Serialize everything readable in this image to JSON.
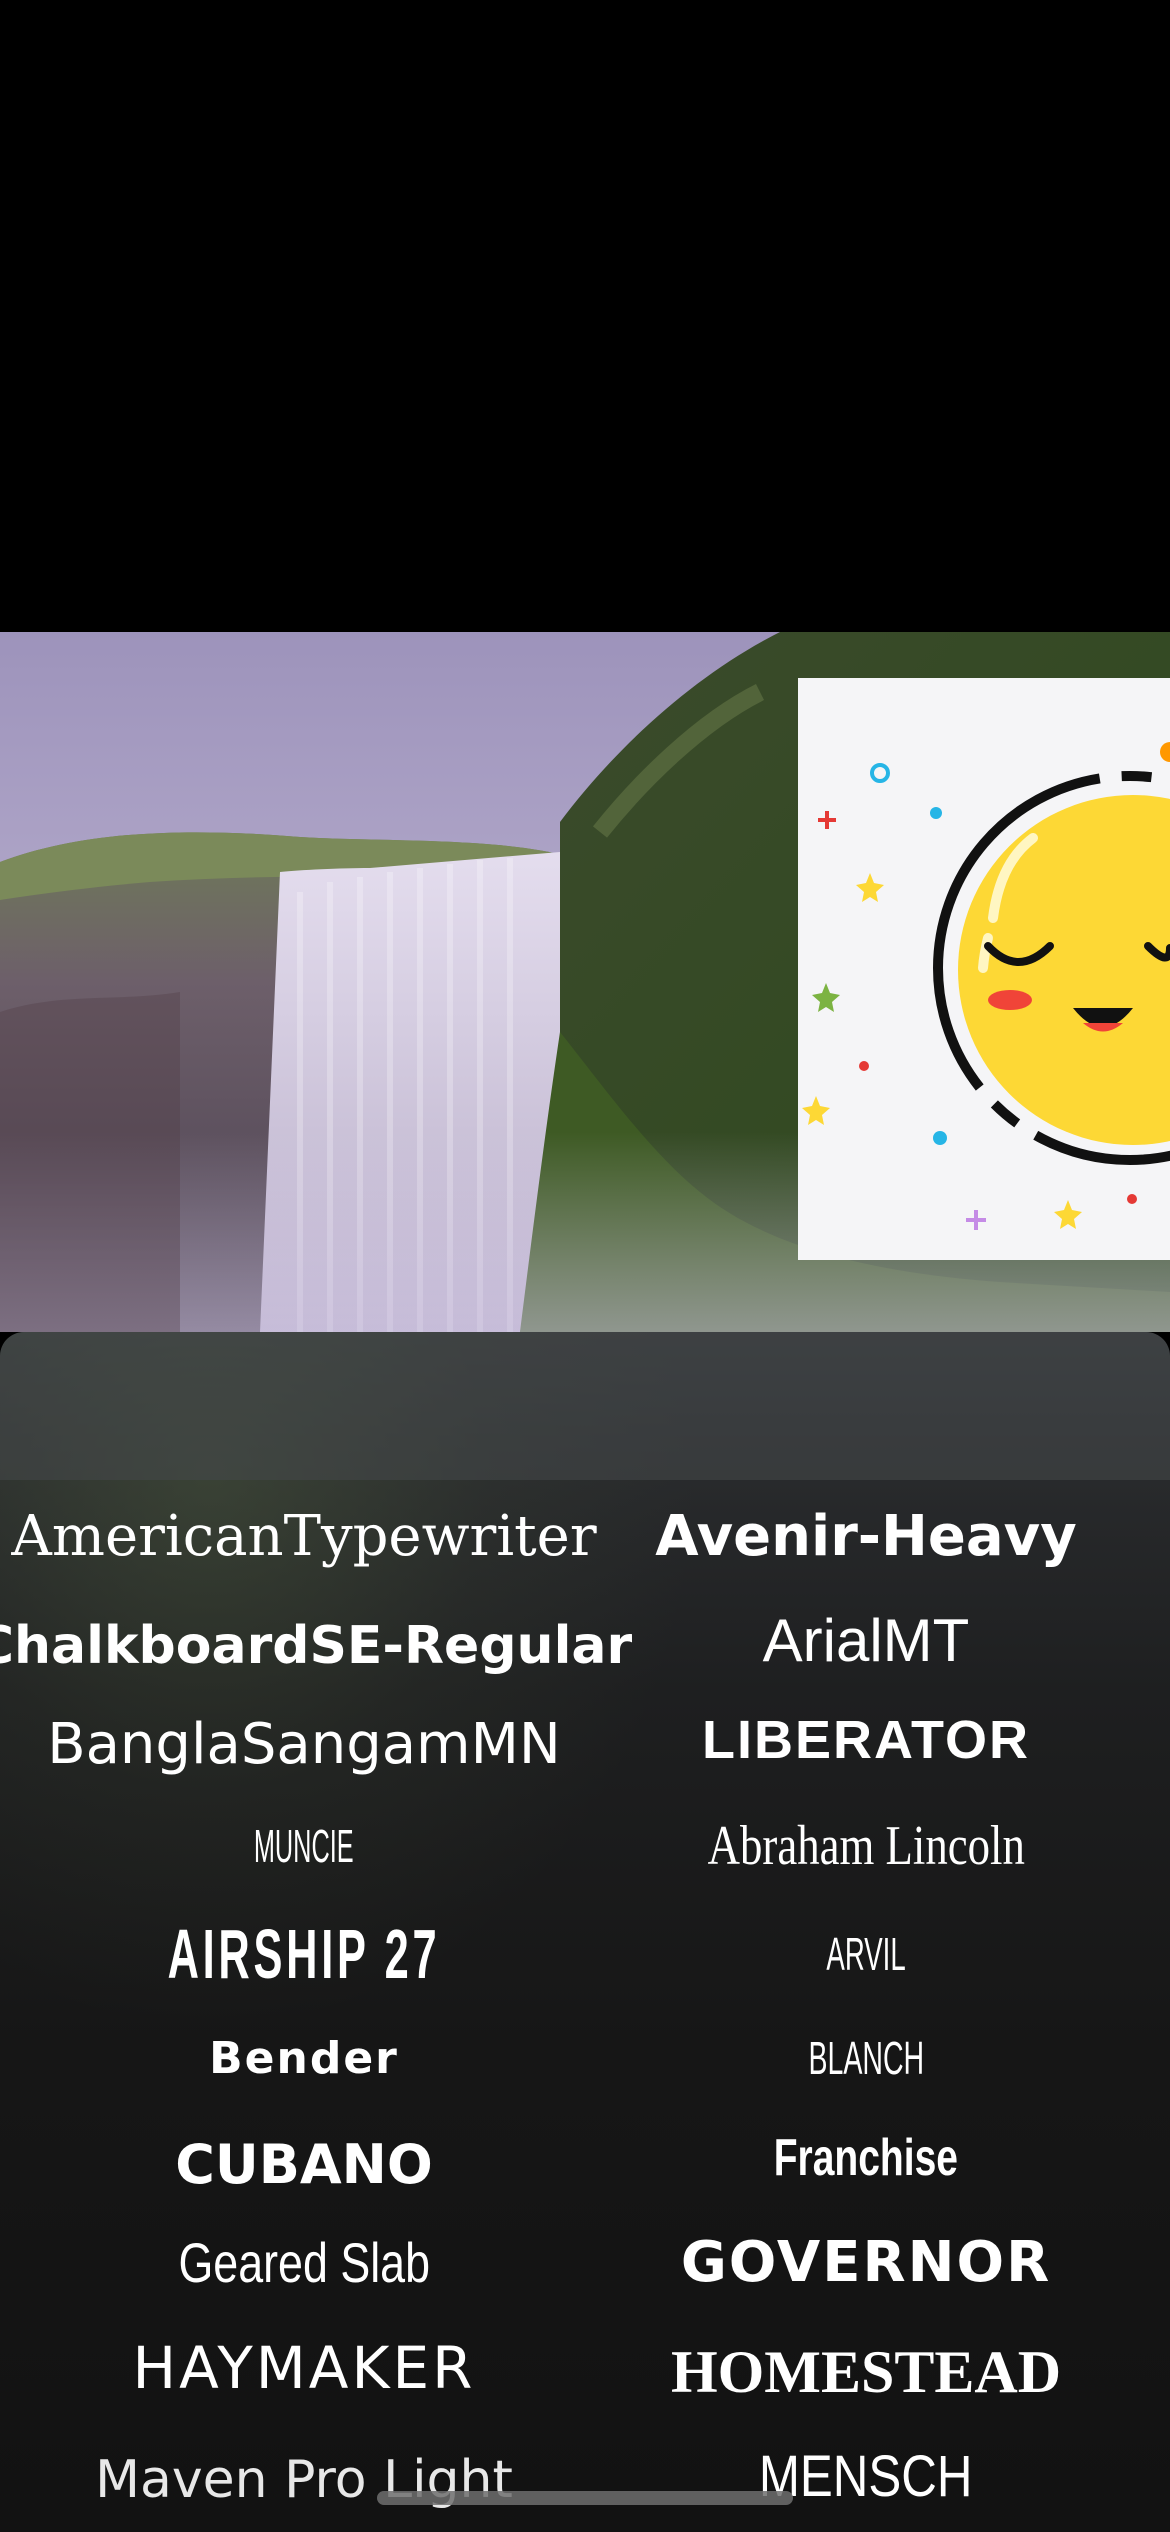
{
  "canvas": {
    "background_image": "waterfall-photo",
    "sticker": "sleeping-smiley-sticker"
  },
  "font_picker": {
    "fonts": [
      {
        "id": "americantypewriter",
        "label": "AmericanTypewriter"
      },
      {
        "id": "avenir-heavy",
        "label": "Avenir-Heavy"
      },
      {
        "id": "chalkboardse-regular",
        "label": "ChalkboardSE-Regular"
      },
      {
        "id": "arialmt",
        "label": "ArialMT"
      },
      {
        "id": "banglasangammn",
        "label": "BanglaSangamMN"
      },
      {
        "id": "liberator",
        "label": "LIBERATOR"
      },
      {
        "id": "muncie",
        "label": "MUNCIE"
      },
      {
        "id": "abraham-lincoln",
        "label": "Abraham Lincoln"
      },
      {
        "id": "airship-27",
        "label": "AIRSHIP 27"
      },
      {
        "id": "arvil",
        "label": "ARVIL"
      },
      {
        "id": "bender",
        "label": "Bender"
      },
      {
        "id": "blanch",
        "label": "BLANCH"
      },
      {
        "id": "cubano",
        "label": "CUBANO"
      },
      {
        "id": "franchise",
        "label": "Franchise"
      },
      {
        "id": "geared-slab",
        "label": "Geared Slab"
      },
      {
        "id": "governor",
        "label": "GOVERNOR"
      },
      {
        "id": "haymaker",
        "label": "HAYMAKER"
      },
      {
        "id": "homestead",
        "label": "HOMESTEAD"
      },
      {
        "id": "maven-pro-light",
        "label": "Maven Pro Light"
      },
      {
        "id": "mensch",
        "label": "MENSCH"
      }
    ]
  },
  "colors": {
    "panel_background": "#161616",
    "panel_header": "#3a3c3e",
    "text": "#ffffff",
    "sticker_face": "#fdd835"
  }
}
